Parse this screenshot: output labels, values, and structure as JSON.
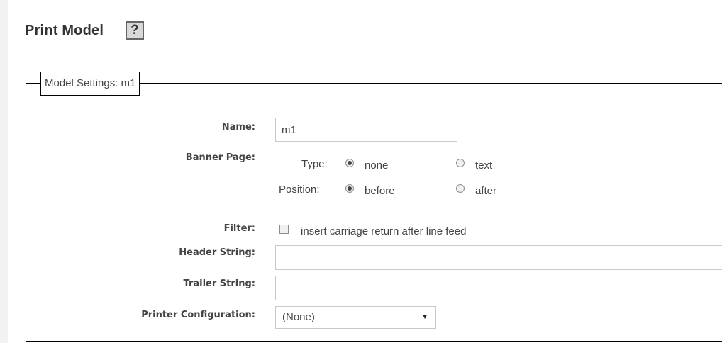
{
  "page": {
    "title": "Print Model",
    "help_glyph": "?"
  },
  "fieldset": {
    "legend": "Model Settings: m1"
  },
  "fields": {
    "name": {
      "label": "Name:",
      "value": "m1"
    },
    "banner_page": {
      "label": "Banner Page:",
      "type": {
        "label": "Type:",
        "options": [
          "none",
          "text"
        ],
        "selected": "none"
      },
      "position": {
        "label": "Position:",
        "options": [
          "before",
          "after"
        ],
        "selected": "before"
      }
    },
    "filter": {
      "label": "Filter:",
      "checkbox_label": "insert carriage return after line feed",
      "checked": false
    },
    "header_string": {
      "label": "Header String:",
      "value": ""
    },
    "trailer_string": {
      "label": "Trailer String:",
      "value": ""
    },
    "printer_configuration": {
      "label": "Printer Configuration:",
      "selected": "(None)"
    }
  },
  "icons": {
    "help": "help-icon",
    "dropdown": "chevron-down-icon"
  }
}
